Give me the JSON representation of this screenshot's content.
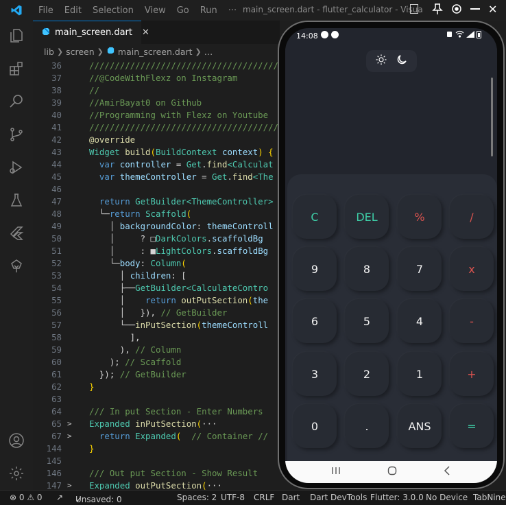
{
  "titlebar": {
    "menu": [
      "File",
      "Edit",
      "Selection",
      "View",
      "Go",
      "Run",
      "···"
    ],
    "window_title": "main_screen.dart - flutter_calculator - Visua"
  },
  "tabs": [
    {
      "label": "main_screen.dart",
      "close": "✕"
    }
  ],
  "breadcrumb": {
    "parts": [
      "lib",
      "screen",
      "main_screen.dart",
      "…"
    ]
  },
  "editor_lines": [
    {
      "n": "36",
      "fold": "",
      "code": [
        [
          "//////////////////////////////////////////",
          "c-comment"
        ]
      ]
    },
    {
      "n": "37",
      "fold": "",
      "code": [
        [
          "//@CodeWithFlexz on Instagram",
          "c-comment"
        ]
      ]
    },
    {
      "n": "38",
      "fold": "",
      "code": [
        [
          "//",
          "c-comment"
        ]
      ]
    },
    {
      "n": "39",
      "fold": "",
      "code": [
        [
          "//AmirBayat0 on Github",
          "c-comment"
        ]
      ]
    },
    {
      "n": "40",
      "fold": "",
      "code": [
        [
          "//Programming with Flexz on Youtube",
          "c-comment"
        ]
      ]
    },
    {
      "n": "41",
      "fold": "",
      "code": [
        [
          "//////////////////////////////////////////",
          "c-comment"
        ]
      ]
    },
    {
      "n": "42",
      "fold": "",
      "code": [
        [
          "@override",
          "c-annot"
        ]
      ]
    },
    {
      "n": "43",
      "fold": "",
      "code": [
        [
          "Widget ",
          "c-type"
        ],
        [
          "build",
          "c-func"
        ],
        [
          "(",
          "c-yellow"
        ],
        [
          "BuildContext ",
          "c-type"
        ],
        [
          "context",
          "c-var"
        ],
        [
          ") {",
          "c-yellow"
        ]
      ]
    },
    {
      "n": "44",
      "fold": "",
      "code": [
        [
          "  var ",
          "c-keyword"
        ],
        [
          "controller ",
          "c-var"
        ],
        [
          "= ",
          "c-plain"
        ],
        [
          "Get",
          "c-type"
        ],
        [
          ".",
          "c-plain"
        ],
        [
          "find",
          "c-func"
        ],
        [
          "<Calculat",
          "c-type"
        ]
      ]
    },
    {
      "n": "45",
      "fold": "",
      "code": [
        [
          "  var ",
          "c-keyword"
        ],
        [
          "themeController ",
          "c-var"
        ],
        [
          "= ",
          "c-plain"
        ],
        [
          "Get",
          "c-type"
        ],
        [
          ".",
          "c-plain"
        ],
        [
          "find",
          "c-func"
        ],
        [
          "<The",
          "c-type"
        ]
      ]
    },
    {
      "n": "46",
      "fold": "",
      "code": []
    },
    {
      "n": "47",
      "fold": "",
      "code": [
        [
          "  return ",
          "c-keyword"
        ],
        [
          "GetBuilder",
          "c-type"
        ],
        [
          "<ThemeController>",
          "c-type"
        ]
      ]
    },
    {
      "n": "48",
      "fold": "",
      "code": [
        [
          "  └─",
          "c-plain"
        ],
        [
          "return ",
          "c-keyword"
        ],
        [
          "Scaffold",
          "c-type"
        ],
        [
          "(",
          "c-yellow"
        ]
      ]
    },
    {
      "n": "49",
      "fold": "",
      "code": [
        [
          "    │ ",
          "c-plain"
        ],
        [
          "backgroundColor",
          "c-var"
        ],
        [
          ": ",
          "c-plain"
        ],
        [
          "themeControll",
          "c-var"
        ]
      ]
    },
    {
      "n": "50",
      "fold": "",
      "code": [
        [
          "    │     ",
          "c-plain"
        ],
        [
          "? ",
          "c-plain"
        ],
        [
          "□",
          "c-plain"
        ],
        [
          "DarkColors",
          "c-type"
        ],
        [
          ".",
          "c-plain"
        ],
        [
          "scaffoldBg",
          "c-var"
        ]
      ]
    },
    {
      "n": "51",
      "fold": "",
      "code": [
        [
          "    │     ",
          "c-plain"
        ],
        [
          ": ",
          "c-plain"
        ],
        [
          "■",
          "c-plain"
        ],
        [
          "LightColors",
          "c-type"
        ],
        [
          ".",
          "c-plain"
        ],
        [
          "scaffoldBg",
          "c-var"
        ]
      ]
    },
    {
      "n": "52",
      "fold": "",
      "code": [
        [
          "    └─",
          "c-plain"
        ],
        [
          "body",
          "c-var"
        ],
        [
          ": ",
          "c-plain"
        ],
        [
          "Column",
          "c-type"
        ],
        [
          "(",
          "c-yellow"
        ]
      ]
    },
    {
      "n": "53",
      "fold": "",
      "code": [
        [
          "      │ ",
          "c-plain"
        ],
        [
          "children",
          "c-var"
        ],
        [
          ": [",
          "c-plain"
        ]
      ]
    },
    {
      "n": "54",
      "fold": "",
      "code": [
        [
          "      ├──",
          "c-plain"
        ],
        [
          "GetBuilder",
          "c-type"
        ],
        [
          "<CalculateContro",
          "c-type"
        ]
      ]
    },
    {
      "n": "55",
      "fold": "",
      "code": [
        [
          "      │    ",
          "c-plain"
        ],
        [
          "return ",
          "c-keyword"
        ],
        [
          "outPutSection",
          "c-func"
        ],
        [
          "(",
          "c-yellow"
        ],
        [
          "the",
          "c-var"
        ]
      ]
    },
    {
      "n": "56",
      "fold": "",
      "code": [
        [
          "      │   }), ",
          "c-plain"
        ],
        [
          "// GetBuilder",
          "c-comment"
        ]
      ]
    },
    {
      "n": "57",
      "fold": "",
      "code": [
        [
          "      └──",
          "c-plain"
        ],
        [
          "inPutSection",
          "c-func"
        ],
        [
          "(",
          "c-yellow"
        ],
        [
          "themeControll",
          "c-var"
        ]
      ]
    },
    {
      "n": "58",
      "fold": "",
      "code": [
        [
          "        ],",
          "c-plain"
        ]
      ]
    },
    {
      "n": "59",
      "fold": "",
      "code": [
        [
          "      ), ",
          "c-plain"
        ],
        [
          "// Column",
          "c-comment"
        ]
      ]
    },
    {
      "n": "60",
      "fold": "",
      "code": [
        [
          "    ); ",
          "c-plain"
        ],
        [
          "// Scaffold",
          "c-comment"
        ]
      ]
    },
    {
      "n": "61",
      "fold": "",
      "code": [
        [
          "  }); ",
          "c-plain"
        ],
        [
          "// GetBuilder",
          "c-comment"
        ]
      ]
    },
    {
      "n": "62",
      "fold": "",
      "code": [
        [
          "}",
          "c-yellow"
        ]
      ]
    },
    {
      "n": "63",
      "fold": "",
      "code": []
    },
    {
      "n": "64",
      "fold": "",
      "code": [
        [
          "/// In put Section - Enter Numbers",
          "c-comment"
        ]
      ]
    },
    {
      "n": "65",
      "fold": ">",
      "code": [
        [
          "Expanded ",
          "c-type"
        ],
        [
          "inPutSection",
          "c-func"
        ],
        [
          "(",
          "c-yellow"
        ],
        [
          "···",
          "c-plain"
        ]
      ]
    },
    {
      "n": "67",
      "fold": ">",
      "code": [
        [
          "  return ",
          "c-keyword"
        ],
        [
          "Expanded",
          "c-type"
        ],
        [
          "(  ",
          "c-yellow"
        ],
        [
          "// Container //",
          "c-comment"
        ]
      ]
    },
    {
      "n": "144",
      "fold": "",
      "code": [
        [
          "}",
          "c-yellow"
        ]
      ]
    },
    {
      "n": "145",
      "fold": "",
      "code": []
    },
    {
      "n": "146",
      "fold": "",
      "code": [
        [
          "/// Out put Section - Show Result",
          "c-comment"
        ]
      ]
    },
    {
      "n": "147",
      "fold": ">",
      "code": [
        [
          "Expanded ",
          "c-type"
        ],
        [
          "outPutSection",
          "c-func"
        ],
        [
          "(",
          "c-yellow"
        ],
        [
          "···",
          "c-plain"
        ]
      ]
    }
  ],
  "statusbar": {
    "problems": "⊗ 0 ⚠ 0",
    "unsaved": "Unsaved: 0",
    "spaces": "Spaces: 2",
    "encoding": "UTF-8",
    "eol": "CRLF",
    "language": "Dart",
    "devtools": "Dart DevTools",
    "flutter": "Flutter: 3.0.0",
    "device": "No Device",
    "tabnine": "TabNine:"
  },
  "phone": {
    "time": "14:08",
    "keys": [
      [
        "C",
        "DEL",
        "%",
        "/"
      ],
      [
        "9",
        "8",
        "7",
        "x"
      ],
      [
        "6",
        "5",
        "4",
        "-"
      ],
      [
        "3",
        "2",
        "1",
        "+"
      ],
      [
        "0",
        ".",
        "ANS",
        "="
      ]
    ],
    "colors": {
      "clear_key": "#3ecfa8",
      "operator_key": "#d9534f",
      "equals_key": "#3ecfa8",
      "digit_key": "#f2f2f2"
    }
  }
}
